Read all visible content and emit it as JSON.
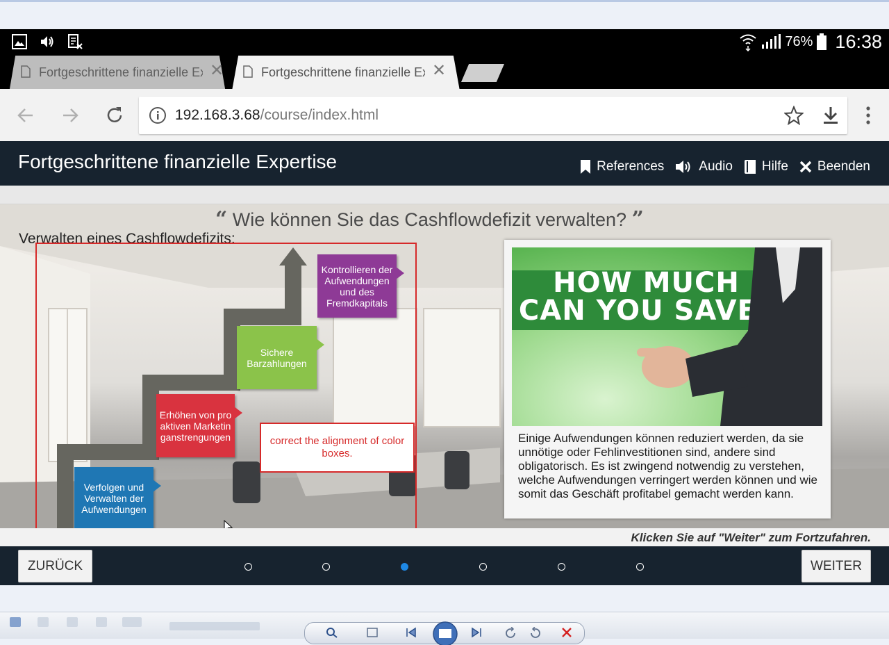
{
  "android_status": {
    "battery_percent": "76%",
    "time": "16:38"
  },
  "browser": {
    "tabs": [
      {
        "label": "Fortgeschrittene finanzielle Expertise",
        "active": false
      },
      {
        "label": "Fortgeschrittene finanzielle Expertise",
        "active": true
      }
    ],
    "url_host": "192.168.3.68",
    "url_path": "/course/index.html"
  },
  "course": {
    "title": "Fortgeschrittene finanzielle Expertise",
    "menu": [
      {
        "icon": "bookmark-icon",
        "label": "References"
      },
      {
        "icon": "speaker-icon",
        "label": "Audio"
      },
      {
        "icon": "book-icon",
        "label": "Hilfe"
      },
      {
        "icon": "close-icon",
        "label": "Beenden"
      }
    ]
  },
  "slide": {
    "question": "Wie können Sie das Cashflowdefizit verwalten?",
    "section_title": "Verwalten eines Cashflowdefizits:",
    "steps": [
      {
        "label": "Verfolgen und Verwalten der Aufwendungen",
        "color": "#1f77b4"
      },
      {
        "label": "Erhöhen von pro aktiven Marketin ganstrengungen",
        "color": "#d9333f"
      },
      {
        "label": "Sichere Barzahlungen",
        "color": "#8bc34a"
      },
      {
        "label": "Kontrollieren der Aufwendungen und des Fremdkapitals",
        "color": "#8e3a96"
      }
    ],
    "review_note": "correct the alignment of color boxes.",
    "promo_line_1": "HOW MUCH",
    "promo_line_2": "CAN YOU SAVE?",
    "card_text": "Einige Aufwendungen können reduziert werden, da sie unnötige oder Fehlinvestitionen sind, andere sind obligatorisch. Es ist zwingend notwendig zu verstehen, welche Aufwendungen verringert werden können und wie somit das Geschäft profitabel gemacht werden kann.",
    "hint": "Klicken Sie auf \"Weiter\" zum Fortzufahren."
  },
  "navigation": {
    "back_label": "ZURÜCK",
    "next_label": "WEITER",
    "page_count": 6,
    "current_page": 3
  },
  "colors": {
    "header_bg": "#17232f",
    "active_dot": "#1e88e5",
    "review_red": "#d62a2a"
  }
}
